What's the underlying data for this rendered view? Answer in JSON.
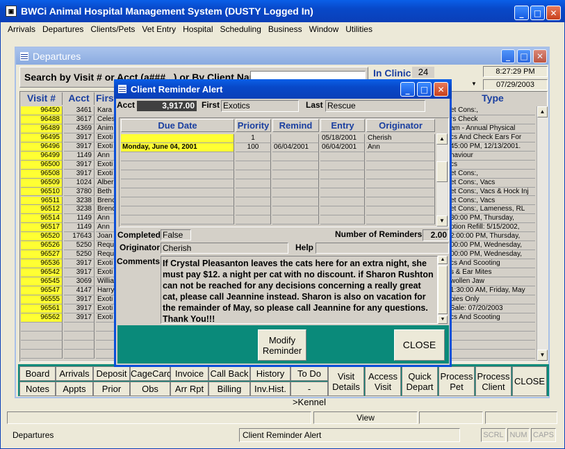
{
  "app": {
    "title": "BWCi Animal Hospital Management System (DUSTY Logged In)"
  },
  "menu": [
    "Arrivals",
    "Departures",
    "Clients/Pets",
    "Vet Entry",
    "Hospital",
    "Scheduling",
    "Business",
    "Window",
    "Utilities"
  ],
  "departures": {
    "title": "Departures",
    "search_label": "Search by Visit # or Acct (a###...) or By Client Name",
    "in_clinic_label": "In Clinic",
    "in_clinic_count": "24",
    "time": "8:27:29 PM",
    "date": "07/29/2003",
    "columns": {
      "visit": "Visit #",
      "acct": "Acct",
      "first": "First",
      "type": "Type"
    },
    "rows": [
      {
        "visit": "96450",
        "acct": "3461",
        "first": "Kara",
        "type": "et Cons:,"
      },
      {
        "visit": "96488",
        "acct": "3617",
        "first": "Celes",
        "type": "rs Check"
      },
      {
        "visit": "96489",
        "acct": "4369",
        "first": "Anim",
        "type": "am - Annual Physical"
      },
      {
        "visit": "96495",
        "acct": "3917",
        "first": "Exoti",
        "type": "cs And Check Ears For"
      },
      {
        "visit": "96496",
        "acct": "3917",
        "first": "Exoti",
        "type": "45:00 PM, 12/13/2001."
      },
      {
        "visit": "96499",
        "acct": "1149",
        "first": "Ann",
        "type": "haviour"
      },
      {
        "visit": "96500",
        "acct": "3917",
        "first": "Exoti",
        "type": "cs"
      },
      {
        "visit": "96508",
        "acct": "3917",
        "first": "Exoti",
        "type": "et Cons:,"
      },
      {
        "visit": "96509",
        "acct": "1024",
        "first": "Alber",
        "type": "et Cons:, Vacs"
      },
      {
        "visit": "96510",
        "acct": "3780",
        "first": "Beth",
        "type": "et Cons:, Vacs & Hock Inj"
      },
      {
        "visit": "96511",
        "acct": "3238",
        "first": "Brenc",
        "type": "et Cons:, Vacs"
      },
      {
        "visit": "96512",
        "acct": "3238",
        "first": "Brenc",
        "type": "et Cons:, Lameness, RL"
      },
      {
        "visit": "96514",
        "acct": "1149",
        "first": "Ann",
        "type": "30:00 PM, Thursday,"
      },
      {
        "visit": "96517",
        "acct": "1149",
        "first": "Ann",
        "type": "ption Refill: 5/15/2002,"
      },
      {
        "visit": "96520",
        "acct": "17643",
        "first": "Joan",
        "type": "2:00:00 PM, Thursday,"
      },
      {
        "visit": "96526",
        "acct": "5250",
        "first": "Requ",
        "type": "00:00 PM, Wednesday,"
      },
      {
        "visit": "96527",
        "acct": "5250",
        "first": "Requ",
        "type": "00:00 PM, Wednesday,"
      },
      {
        "visit": "96536",
        "acct": "3917",
        "first": "Exoti",
        "type": "cs And Scooting"
      },
      {
        "visit": "96542",
        "acct": "3917",
        "first": "Exoti",
        "type": "s & Ear Mites"
      },
      {
        "visit": "96545",
        "acct": "3069",
        "first": "Willia",
        "type": "wollen Jaw"
      },
      {
        "visit": "96547",
        "acct": "4147",
        "first": "Harry",
        "type": "1:30:00 AM, Friday, May"
      },
      {
        "visit": "96555",
        "acct": "3917",
        "first": "Exoti",
        "type": "bies Only"
      },
      {
        "visit": "96561",
        "acct": "3917",
        "first": "Exoti",
        "type": "Sale: 07/20/2003"
      },
      {
        "visit": "96562",
        "acct": "3917",
        "first": "Exoti",
        "type": "cs And Scooting"
      }
    ],
    "buttons_row1": [
      "Board",
      "Arrivals",
      "Deposit",
      "CageCard",
      "Invoice",
      "Call Back",
      "History",
      "To Do"
    ],
    "buttons_row2": [
      "Notes",
      "Appts",
      "Prior",
      "Obs",
      "Arr Rpt",
      "Billing",
      "Inv.Hist.",
      "->Kennel"
    ],
    "buttons_big": [
      "Visit\nDetails",
      "Access\nVisit",
      "Quick\nDepart",
      "Process\nPet",
      "Process\nClient",
      "CLOSE"
    ],
    "status_view": "View"
  },
  "dialog": {
    "title": "Client Reminder Alert",
    "acct_label": "Acct",
    "acct_value": "3,917.00",
    "first_label": "First",
    "first_value": "Exotics",
    "last_label": "Last",
    "last_value": "Rescue",
    "columns": [
      "Due Date",
      "Priority",
      "Remind",
      "Entry",
      "Originator"
    ],
    "rows": [
      {
        "due": "",
        "priority": "1",
        "remind": "",
        "entry": "05/18/2001",
        "originator": "Cherish"
      },
      {
        "due": "Monday, June 04, 2001",
        "priority": "100",
        "remind": "06/04/2001",
        "entry": "06/04/2001",
        "originator": "Ann"
      }
    ],
    "completed_label": "Completed",
    "completed_value": "False",
    "num_reminders_label": "Number of Reminders",
    "num_reminders_value": "2.00",
    "originator_label": "Originator",
    "originator_value": "Cherish",
    "help_label": "Help",
    "help_value": "",
    "comments_label": "Comments",
    "comments": "If Crystal Pleasanton leaves the cats here for an extra night, she must pay $12. a night per cat with no discount.  if Sharon Rushton can not be reached for any decisions concerning a really great cat, please call Jeannine instead.  Sharon is also on vacation for the remainder of May, so please call Jeannine for any questions.  Thank You!!!",
    "modify_label": "Modify\nReminder",
    "close_label": "CLOSE"
  },
  "statusbar": {
    "left": "Departures",
    "middle": "Client Reminder Alert",
    "scrl": "SCRL",
    "num": "NUM",
    "caps": "CAPS"
  }
}
